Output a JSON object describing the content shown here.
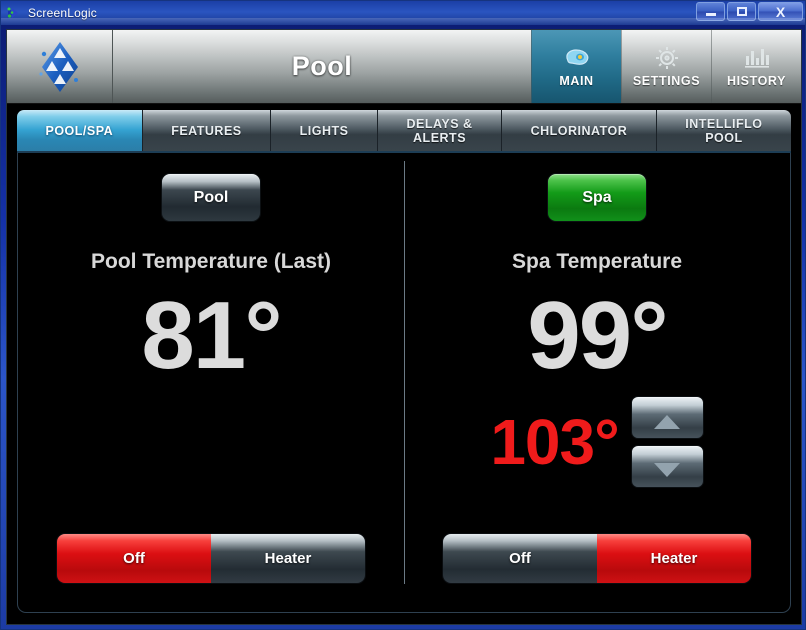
{
  "window": {
    "app_title": "ScreenLogic",
    "app_icon": "screenlogic-arrow-icon",
    "minimize_label": "Minimize",
    "maximize_label": "Maximize",
    "close_label": "X"
  },
  "header": {
    "logo_name": "pentair-logo",
    "title": "Pool",
    "nav": [
      {
        "label": "MAIN",
        "icon": "pool-icon",
        "active": true
      },
      {
        "label": "SETTINGS",
        "icon": "gear-icon",
        "active": false
      },
      {
        "label": "HISTORY",
        "icon": "bar-chart-icon",
        "active": false
      }
    ]
  },
  "tabs": [
    {
      "line1": "POOL/SPA",
      "line2": "",
      "active": true
    },
    {
      "line1": "FEATURES",
      "line2": "",
      "active": false
    },
    {
      "line1": "LIGHTS",
      "line2": "",
      "active": false
    },
    {
      "line1": "DELAYS &",
      "line2": "ALERTS",
      "active": false
    },
    {
      "line1": "CHLORINATOR",
      "line2": "",
      "active": false
    },
    {
      "line1": "INTELLIFLO",
      "line2": "POOL",
      "active": false
    }
  ],
  "pool_panel": {
    "circuit_button_label": "Pool",
    "circuit_state": "off",
    "temperature_label": "Pool Temperature (Last)",
    "current_temperature": "81°",
    "heat_modes": [
      {
        "label": "Off",
        "active": true
      },
      {
        "label": "Heater",
        "active": false
      }
    ]
  },
  "spa_panel": {
    "circuit_button_label": "Spa",
    "circuit_state": "on",
    "temperature_label": "Spa Temperature",
    "current_temperature": "99°",
    "setpoint_temperature": "103°",
    "stepper_up": "increase-setpoint",
    "stepper_down": "decrease-setpoint",
    "heat_modes": [
      {
        "label": "Off",
        "active": false
      },
      {
        "label": "Heater",
        "active": true
      }
    ]
  },
  "colors": {
    "accent_teal": "#2f7e9e",
    "tab_active_blue": "#35a3d2",
    "on_green": "#139b18",
    "alert_red": "#f01b1b",
    "heat_red": "#dc0f12",
    "text_gray": "#dcdcdc"
  }
}
